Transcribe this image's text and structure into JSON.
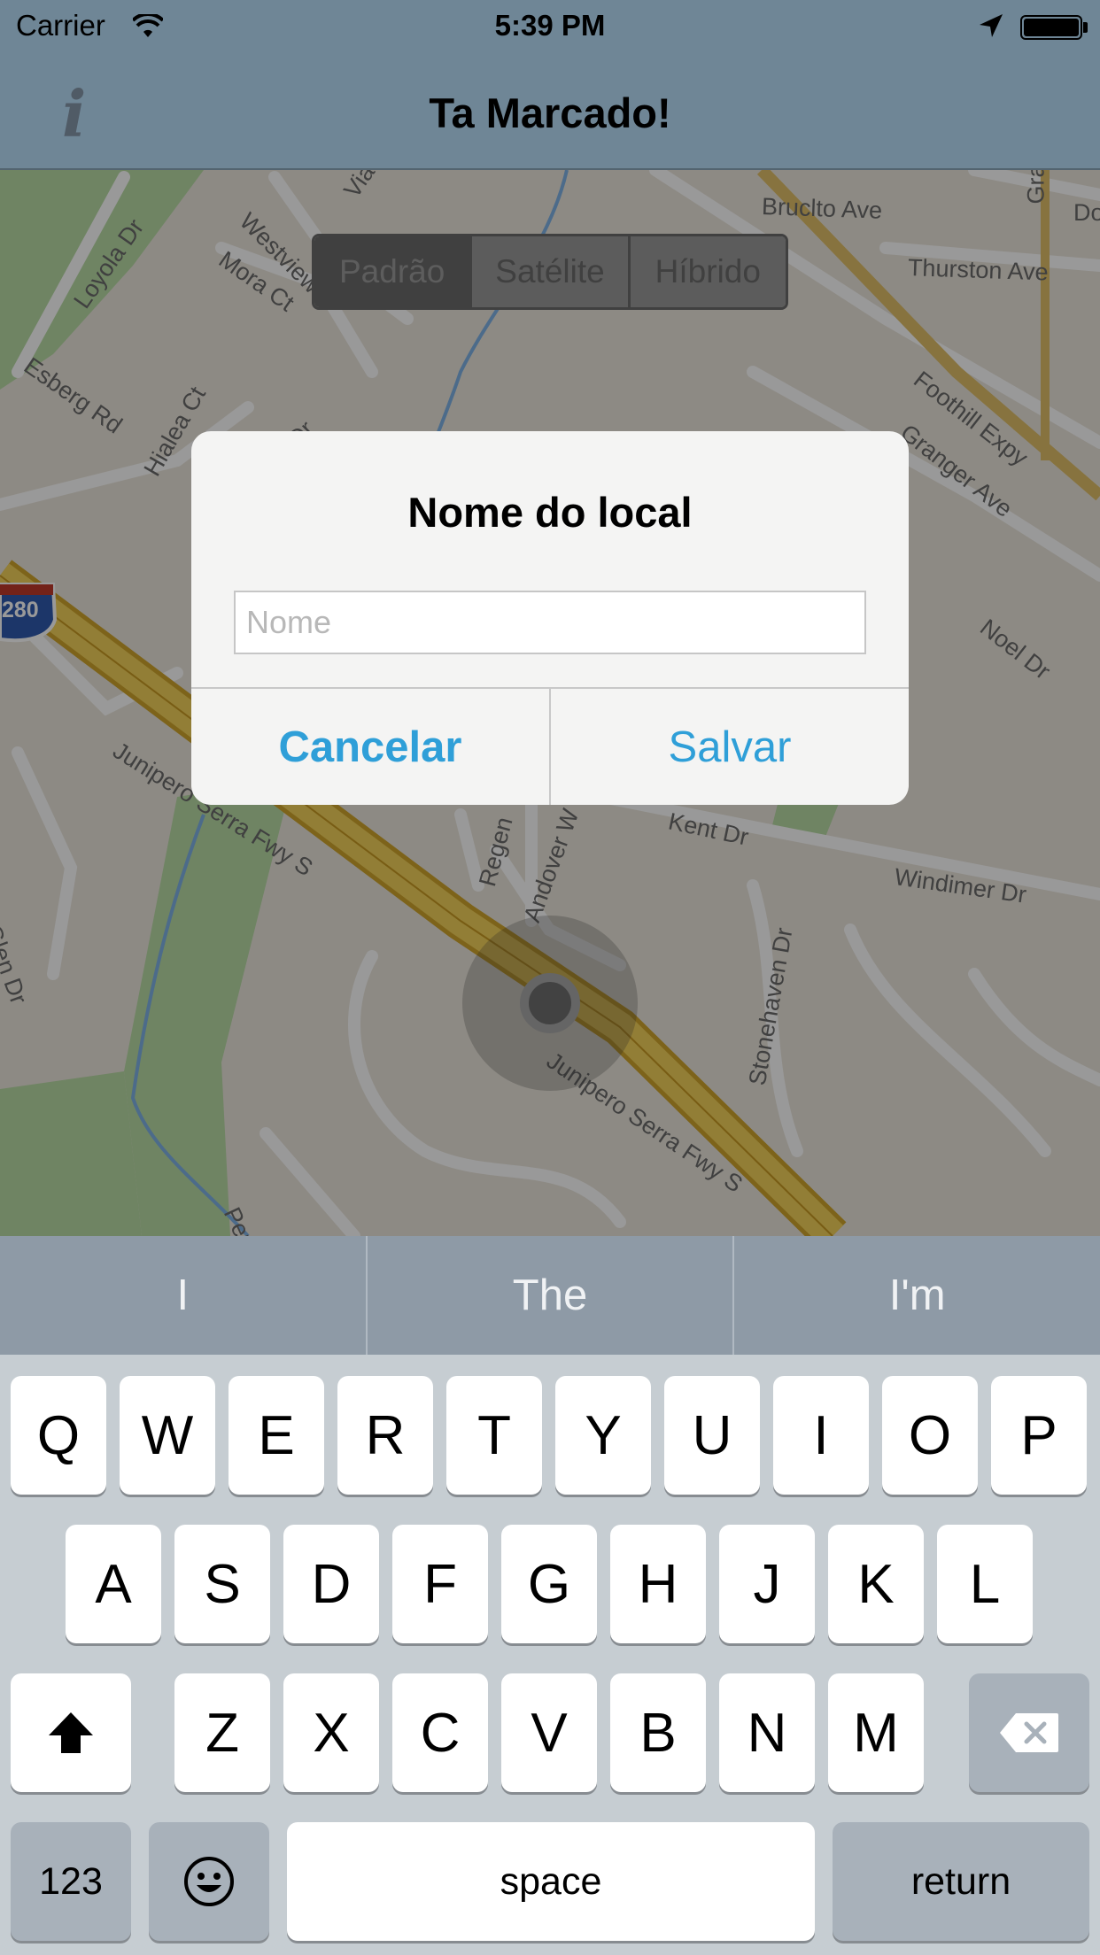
{
  "status_bar": {
    "carrier": "Carrier",
    "time": "5:39 PM",
    "wifi_icon": "wifi-icon",
    "location_icon": "location-arrow-icon",
    "battery_icon": "battery-icon"
  },
  "nav_bar": {
    "info_glyph": "i",
    "title": "Ta Marcado!"
  },
  "map": {
    "segments": [
      "Padrão",
      "Satélite",
      "Híbrido"
    ],
    "selected_segment": "Padrão",
    "highway_shield": "280",
    "road_labels": [
      "Bruclto Ave",
      "Thurston Ave",
      "Foothill Expy",
      "Granger Ave",
      "Loyola Dr",
      "Mora Ct",
      "Esberg Rd",
      "Hialea Ct",
      "Noel Dr",
      "Junipero Serra Fwy S",
      "Regen",
      "Andover W",
      "Kent Dr",
      "Windimer Dr",
      "Stonehaven Dr",
      "Junipero Serra Fwy S",
      "Glen Dr",
      "Perm",
      "Westview",
      "Dr",
      "Gra",
      "Do",
      "Via"
    ]
  },
  "alert": {
    "title": "Nome do local",
    "input_value": "",
    "input_placeholder": "Nome",
    "cancel_label": "Cancelar",
    "save_label": "Salvar",
    "accent_color": "#2f9fd8"
  },
  "keyboard": {
    "suggestions": [
      "I",
      "The",
      "I'm"
    ],
    "row1": [
      "Q",
      "W",
      "E",
      "R",
      "T",
      "Y",
      "U",
      "I",
      "O",
      "P"
    ],
    "row2": [
      "A",
      "S",
      "D",
      "F",
      "G",
      "H",
      "J",
      "K",
      "L"
    ],
    "row3": [
      "Z",
      "X",
      "C",
      "V",
      "B",
      "N",
      "M"
    ],
    "shift_icon": "shift-arrow-icon",
    "delete_icon": "delete-backspace-icon",
    "emoji_icon": "emoji-face-icon",
    "numbers_label": "123",
    "space_label": "space",
    "return_label": "return"
  }
}
